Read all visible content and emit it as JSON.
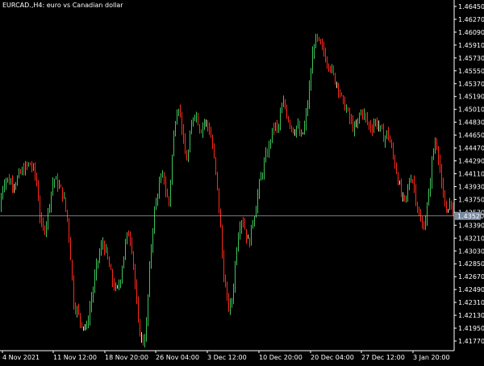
{
  "window": {
    "title": "EURCAD.,H4:  euro vs Canadian dollar"
  },
  "colors": {
    "background": "#000000",
    "bull": "#3dc45a",
    "bear": "#ff2a1a",
    "doji": "#f5e6b0",
    "axis": "#ffffff",
    "price_line": "#c8c8c8",
    "price_tag_bg": "#7a8aa0"
  },
  "chart_data": {
    "type": "candlestick",
    "symbol": "EURCAD.",
    "timeframe": "H4",
    "ylim": [
      1.4155,
      1.4655
    ],
    "y_ticks": [
      "1.46450",
      "1.46270",
      "1.46090",
      "1.45910",
      "1.45730",
      "1.45550",
      "1.45370",
      "1.45190",
      "1.45010",
      "1.44830",
      "1.44650",
      "1.44470",
      "1.44290",
      "1.44110",
      "1.43930",
      "1.43750",
      "1.43570",
      "1.43390",
      "1.43210",
      "1.43030",
      "1.42850",
      "1.42670",
      "1.42490",
      "1.42310",
      "1.42130",
      "1.41950",
      "1.41770"
    ],
    "x_ticks": [
      "4 Nov 2021",
      "11 Nov 12:00",
      "18 Nov 20:00",
      "26 Nov 04:00",
      "3 Dec 12:00",
      "10 Dec 20:00",
      "20 Dec 04:00",
      "27 Dec 12:00",
      "3 Jan 20:00"
    ],
    "current_price": "1.43520",
    "current_price_value": 1.4352,
    "path_points": [
      [
        0,
        1.4348
      ],
      [
        4,
        1.439
      ],
      [
        8,
        1.4405
      ],
      [
        14,
        1.44
      ],
      [
        20,
        1.4398
      ],
      [
        26,
        1.441
      ],
      [
        32,
        1.4418
      ],
      [
        38,
        1.4425
      ],
      [
        44,
        1.4415
      ],
      [
        48,
        1.439
      ],
      [
        52,
        1.434
      ],
      [
        56,
        1.433
      ],
      [
        60,
        1.435
      ],
      [
        64,
        1.438
      ],
      [
        68,
        1.4405
      ],
      [
        74,
        1.4395
      ],
      [
        80,
        1.438
      ],
      [
        86,
        1.434
      ],
      [
        90,
        1.428
      ],
      [
        93,
        1.423
      ],
      [
        97,
        1.422
      ],
      [
        101,
        1.4205
      ],
      [
        105,
        1.42
      ],
      [
        109,
        1.4195
      ],
      [
        113,
        1.4225
      ],
      [
        117,
        1.425
      ],
      [
        121,
        1.428
      ],
      [
        125,
        1.43
      ],
      [
        129,
        1.4315
      ],
      [
        133,
        1.43
      ],
      [
        137,
        1.428
      ],
      [
        141,
        1.426
      ],
      [
        146,
        1.4245
      ],
      [
        150,
        1.426
      ],
      [
        154,
        1.429
      ],
      [
        158,
        1.432
      ],
      [
        162,
        1.433
      ],
      [
        166,
        1.43
      ],
      [
        170,
        1.424
      ],
      [
        173,
        1.42
      ],
      [
        177,
        1.418
      ],
      [
        180,
        1.4175
      ],
      [
        183,
        1.42
      ],
      [
        186,
        1.426
      ],
      [
        189,
        1.431
      ],
      [
        192,
        1.435
      ],
      [
        196,
        1.438
      ],
      [
        200,
        1.44
      ],
      [
        204,
        1.441
      ],
      [
        208,
        1.438
      ],
      [
        211,
        1.437
      ],
      [
        214,
        1.442
      ],
      [
        218,
        1.448
      ],
      [
        222,
        1.451
      ],
      [
        226,
        1.449
      ],
      [
        230,
        1.444
      ],
      [
        234,
        1.443
      ],
      [
        238,
        1.447
      ],
      [
        242,
        1.45
      ],
      [
        246,
        1.449
      ],
      [
        250,
        1.447
      ],
      [
        254,
        1.4485
      ],
      [
        258,
        1.448
      ],
      [
        262,
        1.447
      ],
      [
        266,
        1.444
      ],
      [
        270,
        1.44
      ],
      [
        274,
        1.435
      ],
      [
        278,
        1.428
      ],
      [
        282,
        1.424
      ],
      [
        286,
        1.422
      ],
      [
        290,
        1.424
      ],
      [
        294,
        1.43
      ],
      [
        298,
        1.434
      ],
      [
        302,
        1.435
      ],
      [
        306,
        1.433
      ],
      [
        310,
        1.431
      ],
      [
        314,
        1.434
      ],
      [
        318,
        1.436
      ],
      [
        322,
        1.439
      ],
      [
        326,
        1.441
      ],
      [
        330,
        1.443
      ],
      [
        334,
        1.4445
      ],
      [
        338,
        1.4465
      ],
      [
        342,
        1.448
      ],
      [
        346,
        1.447
      ],
      [
        350,
        1.45
      ],
      [
        354,
        1.451
      ],
      [
        358,
        1.449
      ],
      [
        362,
        1.448
      ],
      [
        366,
        1.447
      ],
      [
        370,
        1.448
      ],
      [
        374,
        1.446
      ],
      [
        378,
        1.447
      ],
      [
        382,
        1.45
      ],
      [
        386,
        1.454
      ],
      [
        390,
        1.459
      ],
      [
        394,
        1.46
      ],
      [
        398,
        1.459
      ],
      [
        402,
        1.4585
      ],
      [
        406,
        1.457
      ],
      [
        410,
        1.4565
      ],
      [
        414,
        1.455
      ],
      [
        418,
        1.454
      ],
      [
        422,
        1.453
      ],
      [
        426,
        1.451
      ],
      [
        430,
        1.4505
      ],
      [
        434,
        1.449
      ],
      [
        438,
        1.448
      ],
      [
        442,
        1.447
      ],
      [
        446,
        1.449
      ],
      [
        450,
        1.45
      ],
      [
        454,
        1.449
      ],
      [
        458,
        1.448
      ],
      [
        462,
        1.4475
      ],
      [
        466,
        1.4485
      ],
      [
        470,
        1.448
      ],
      [
        474,
        1.447
      ],
      [
        478,
        1.446
      ],
      [
        482,
        1.447
      ],
      [
        486,
        1.445
      ],
      [
        490,
        1.443
      ],
      [
        494,
        1.441
      ],
      [
        498,
        1.4385
      ],
      [
        502,
        1.437
      ],
      [
        506,
        1.438
      ],
      [
        510,
        1.441
      ],
      [
        514,
        1.44
      ],
      [
        518,
        1.437
      ],
      [
        522,
        1.4345
      ],
      [
        526,
        1.4335
      ],
      [
        530,
        1.4355
      ],
      [
        534,
        1.439
      ],
      [
        538,
        1.444
      ],
      [
        542,
        1.446
      ],
      [
        546,
        1.443
      ],
      [
        550,
        1.438
      ],
      [
        554,
        1.436
      ],
      [
        558,
        1.437
      ],
      [
        562,
        1.436
      ]
    ]
  }
}
